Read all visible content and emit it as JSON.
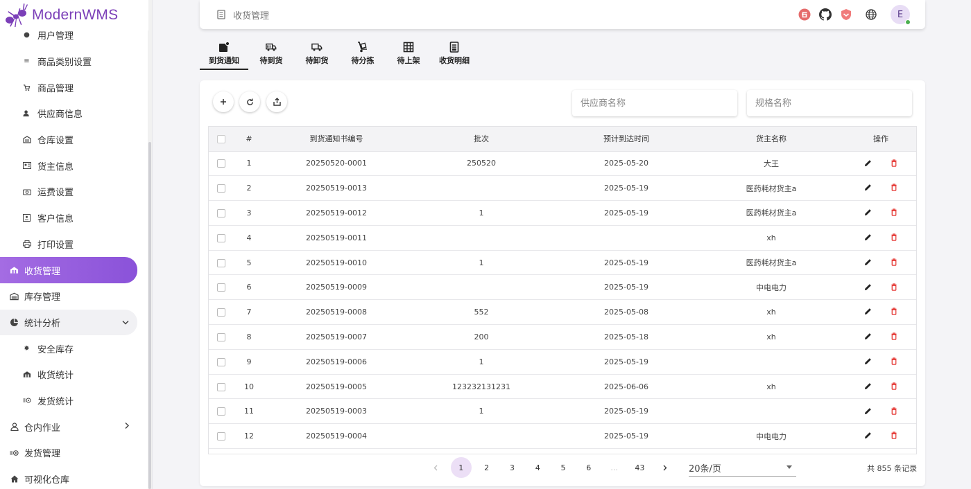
{
  "app": {
    "name": "ModernWMS"
  },
  "sidebar": {
    "items": [
      {
        "label": "用户管理",
        "icon": "user-icon",
        "level": "sub"
      },
      {
        "label": "商品类别设置",
        "icon": "list-icon",
        "level": "sub"
      },
      {
        "label": "商品管理",
        "icon": "cart-icon",
        "level": "sub"
      },
      {
        "label": "供应商信息",
        "icon": "supplier-icon",
        "level": "sub"
      },
      {
        "label": "仓库设置",
        "icon": "warehouse-icon",
        "level": "sub"
      },
      {
        "label": "货主信息",
        "icon": "owner-icon",
        "level": "sub"
      },
      {
        "label": "运费设置",
        "icon": "freight-icon",
        "level": "sub"
      },
      {
        "label": "客户信息",
        "icon": "customer-icon",
        "level": "sub"
      },
      {
        "label": "打印设置",
        "icon": "printer-icon",
        "level": "sub"
      },
      {
        "label": "收货管理",
        "icon": "receiving-icon",
        "level": "top",
        "active": true
      },
      {
        "label": "库存管理",
        "icon": "stock-icon",
        "level": "top"
      },
      {
        "label": "统计分析",
        "icon": "pie-chart-icon",
        "level": "top",
        "expanded": true
      },
      {
        "label": "安全库存",
        "icon": "safety-icon",
        "level": "sub"
      },
      {
        "label": "收货统计",
        "icon": "receiving-stats-icon",
        "level": "sub"
      },
      {
        "label": "发货统计",
        "icon": "shipping-stats-icon",
        "level": "sub"
      },
      {
        "label": "仓内作业",
        "icon": "worker-icon",
        "level": "top",
        "collapsed": true
      },
      {
        "label": "发货管理",
        "icon": "shipping-icon",
        "level": "top"
      },
      {
        "label": "可视化仓库",
        "icon": "home-icon",
        "level": "top"
      }
    ]
  },
  "header": {
    "title": "收货管理",
    "icons": [
      "gitee-icon",
      "github-icon",
      "shield-logo-icon",
      "globe-icon"
    ],
    "avatar_letter": "E"
  },
  "tabs": [
    {
      "label": "到货通知",
      "icon": "notice-icon",
      "active": true
    },
    {
      "label": "待到货",
      "icon": "truck-icon"
    },
    {
      "label": "待卸货",
      "icon": "delivery-truck-icon"
    },
    {
      "label": "待分拣",
      "icon": "hand-truck-icon"
    },
    {
      "label": "待上架",
      "icon": "grid-shelf-icon"
    },
    {
      "label": "收货明细",
      "icon": "receipt-icon"
    }
  ],
  "toolbar": {
    "buttons": [
      "plus-icon",
      "refresh-icon",
      "export-icon"
    ],
    "supplier_placeholder": "供应商名称",
    "spec_placeholder": "规格名称"
  },
  "table": {
    "columns": [
      "#",
      "到货通知书编号",
      "批次",
      "预计到达时间",
      "货主名称",
      "操作"
    ],
    "rows": [
      {
        "no": "1",
        "code": "20250520-0001",
        "batch": "250520",
        "eta": "2025-05-20",
        "owner": "大王"
      },
      {
        "no": "2",
        "code": "20250519-0013",
        "batch": "",
        "eta": "2025-05-19",
        "owner": "医药耗材货主a"
      },
      {
        "no": "3",
        "code": "20250519-0012",
        "batch": "1",
        "eta": "2025-05-19",
        "owner": "医药耗材货主a"
      },
      {
        "no": "4",
        "code": "20250519-0011",
        "batch": "",
        "eta": "",
        "owner": "xh"
      },
      {
        "no": "5",
        "code": "20250519-0010",
        "batch": "1",
        "eta": "2025-05-19",
        "owner": "医药耗材货主a"
      },
      {
        "no": "6",
        "code": "20250519-0009",
        "batch": "",
        "eta": "2025-05-19",
        "owner": "中电电力"
      },
      {
        "no": "7",
        "code": "20250519-0008",
        "batch": "552",
        "eta": "2025-05-08",
        "owner": "xh"
      },
      {
        "no": "8",
        "code": "20250519-0007",
        "batch": "200",
        "eta": "2025-05-18",
        "owner": "xh"
      },
      {
        "no": "9",
        "code": "20250519-0006",
        "batch": "1",
        "eta": "2025-05-19",
        "owner": ""
      },
      {
        "no": "10",
        "code": "20250519-0005",
        "batch": "123232131231",
        "eta": "2025-06-06",
        "owner": "xh"
      },
      {
        "no": "11",
        "code": "20250519-0003",
        "batch": "1",
        "eta": "2025-05-19",
        "owner": ""
      },
      {
        "no": "12",
        "code": "20250519-0004",
        "batch": "",
        "eta": "2025-05-19",
        "owner": "中电电力"
      }
    ]
  },
  "pagination": {
    "pages": [
      "1",
      "2",
      "3",
      "4",
      "5",
      "6",
      "...",
      "43"
    ],
    "current": "1",
    "page_size": "20条/页",
    "total_text": "共 855 条记录"
  },
  "colors": {
    "accent": "#9a5fe0",
    "brand": "#7b3fb8",
    "delete": "#e53935"
  }
}
